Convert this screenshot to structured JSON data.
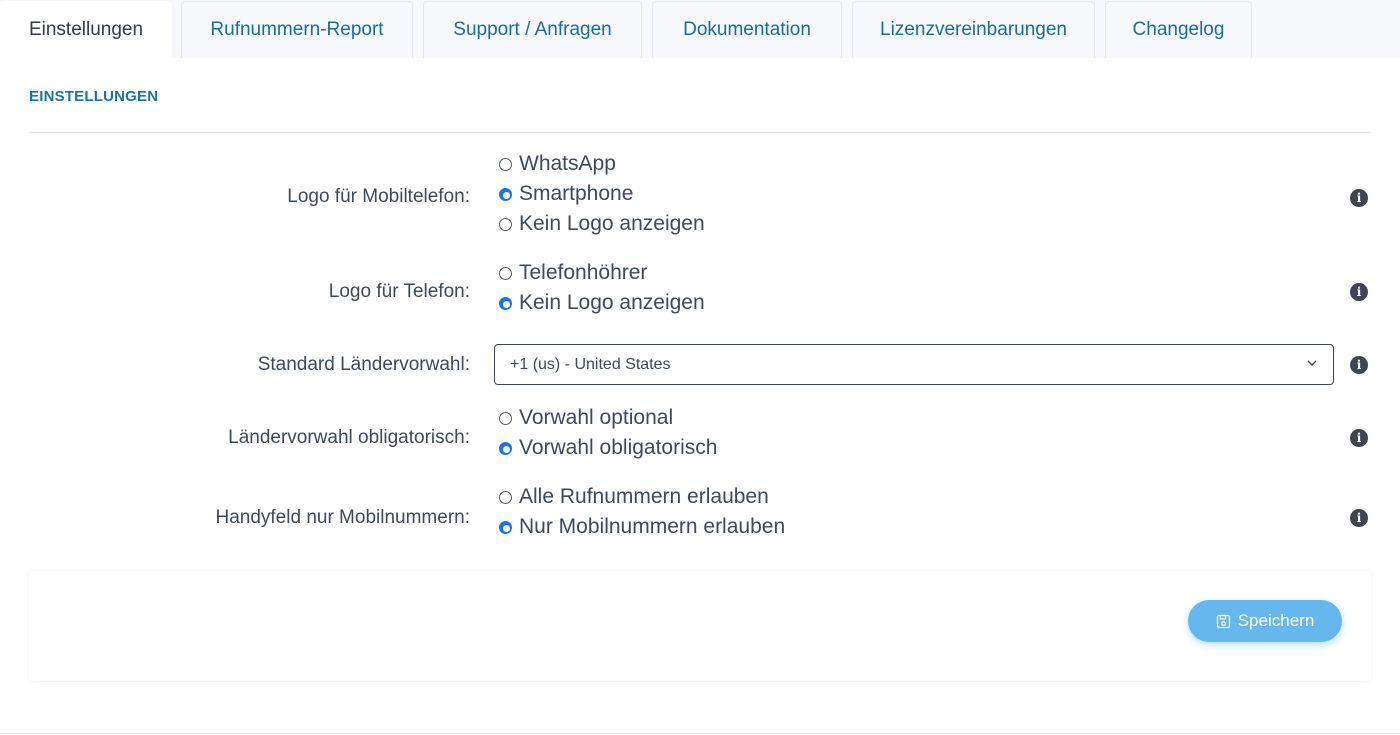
{
  "tabs": [
    {
      "label": "Einstellungen",
      "active": true
    },
    {
      "label": "Rufnummern-Report",
      "active": false
    },
    {
      "label": "Support / Anfragen",
      "active": false
    },
    {
      "label": "Dokumentation",
      "active": false
    },
    {
      "label": "Lizenzvereinbarungen",
      "active": false
    },
    {
      "label": "Changelog",
      "active": false
    }
  ],
  "section": {
    "title": "EINSTELLUNGEN"
  },
  "settings": {
    "mobile_logo": {
      "label": "Logo für Mobiltelefon:",
      "options": [
        {
          "label": "WhatsApp",
          "checked": false
        },
        {
          "label": "Smartphone",
          "checked": true
        },
        {
          "label": "Kein Logo anzeigen",
          "checked": false
        }
      ]
    },
    "phone_logo": {
      "label": "Logo für Telefon:",
      "options": [
        {
          "label": "Telefonhöhrer",
          "checked": false
        },
        {
          "label": "Kein Logo anzeigen",
          "checked": true
        }
      ]
    },
    "country_code": {
      "label": "Standard Ländervorwahl:",
      "selected": "+1 (us) - United States"
    },
    "code_required": {
      "label": "Ländervorwahl obligatorisch:",
      "options": [
        {
          "label": "Vorwahl optional",
          "checked": false
        },
        {
          "label": "Vorwahl obligatorisch",
          "checked": true
        }
      ]
    },
    "mobile_only": {
      "label": "Handyfeld nur Mobilnummern:",
      "options": [
        {
          "label": "Alle Rufnummern erlauben",
          "checked": false
        },
        {
          "label": "Nur Mobilnummern erlauben",
          "checked": true
        }
      ]
    }
  },
  "footer": {
    "save_label": "Speichern"
  },
  "icons": {
    "info": "info-icon",
    "save": "floppy-disk-icon",
    "select": "chevron-down-icon"
  },
  "colors": {
    "accent": "#1a73a8",
    "radio_checked": "#1a73e8",
    "save_button": "#67b7ef"
  }
}
